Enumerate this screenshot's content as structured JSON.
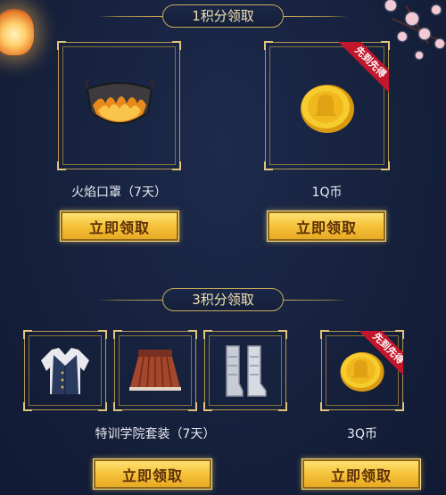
{
  "section1": {
    "title": "1积分领取",
    "rewards": [
      {
        "name": "火焰口罩（7天）",
        "icon": "flame-mask-icon",
        "badge": ""
      },
      {
        "name": "1Q币",
        "icon": "q-coin-icon",
        "badge": "先到先得"
      }
    ],
    "buttons": [
      "立即领取",
      "立即领取"
    ]
  },
  "section2": {
    "title": "3积分领取",
    "rewards": [
      {
        "name": "特训学院套装（7天）",
        "icons": [
          "vest-icon",
          "skirt-icon",
          "boots-icon"
        ],
        "badge": ""
      },
      {
        "name": "3Q币",
        "icon": "q-coin-icon",
        "badge": "先到先得"
      }
    ],
    "buttons": [
      "立即领取",
      "立即领取"
    ]
  },
  "colors": {
    "background": "#17223f",
    "gold": "#c9a85a",
    "button": "#f5c23a",
    "ribbon": "#c1162b"
  }
}
